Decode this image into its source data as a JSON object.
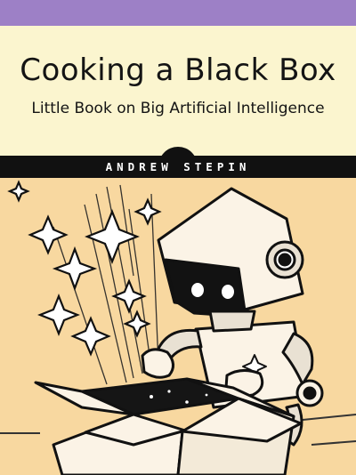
{
  "book": {
    "title": "Cooking a Black Box",
    "subtitle": "Little Book on Big Artificial Intelligence",
    "author": "ANDREW STEPIN"
  },
  "colors": {
    "top_band": "#9d80c6",
    "title_panel": "#fbf5cf",
    "author_bar": "#111111",
    "art_background": "#f8d8a0",
    "ink": "#141414"
  },
  "illustration": {
    "subject": "robot opening a box with sparkles",
    "icons": [
      "robot-icon",
      "box-icon",
      "sparkle-icon"
    ]
  }
}
